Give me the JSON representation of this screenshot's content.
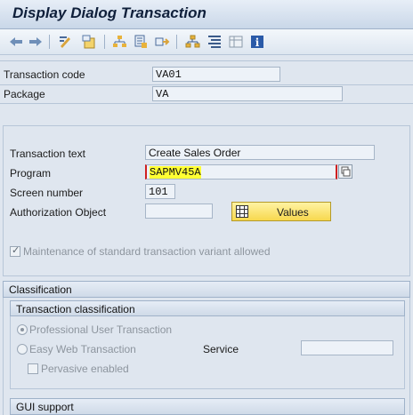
{
  "title": "Display Dialog Transaction",
  "toolbar": {
    "icons": [
      "back-arrow-icon",
      "forward-arrow-icon",
      "display-change-icon",
      "object-list-icon",
      "hierarchy-icon",
      "where-used-icon",
      "transport-icon",
      "tree-icon",
      "indent-icon",
      "layout-icon",
      "info-icon"
    ]
  },
  "header": {
    "transaction_code_label": "Transaction code",
    "transaction_code_value": "VA01",
    "package_label": "Package",
    "package_value": "VA"
  },
  "details": {
    "transaction_text_label": "Transaction text",
    "transaction_text_value": "Create Sales Order",
    "program_label": "Program",
    "program_value": "SAPMV45A",
    "screen_number_label": "Screen number",
    "screen_number_value": "101",
    "auth_object_label": "Authorization Object",
    "auth_object_value": "",
    "values_button_label": "Values",
    "maintenance_label": "Maintenance of standard transaction variant allowed",
    "maintenance_checked": true
  },
  "classification": {
    "section_label": "Classification",
    "group_label": "Transaction classification",
    "professional_label": "Professional User Transaction",
    "easy_web_label": "Easy Web Transaction",
    "service_label": "Service",
    "service_value": "",
    "pervasive_label": "Pervasive enabled"
  },
  "gui_support": {
    "label": "GUI support"
  },
  "colors": {
    "highlight": "#ffff33",
    "required_bracket": "#d02020",
    "values_button": "#f7d84e"
  }
}
